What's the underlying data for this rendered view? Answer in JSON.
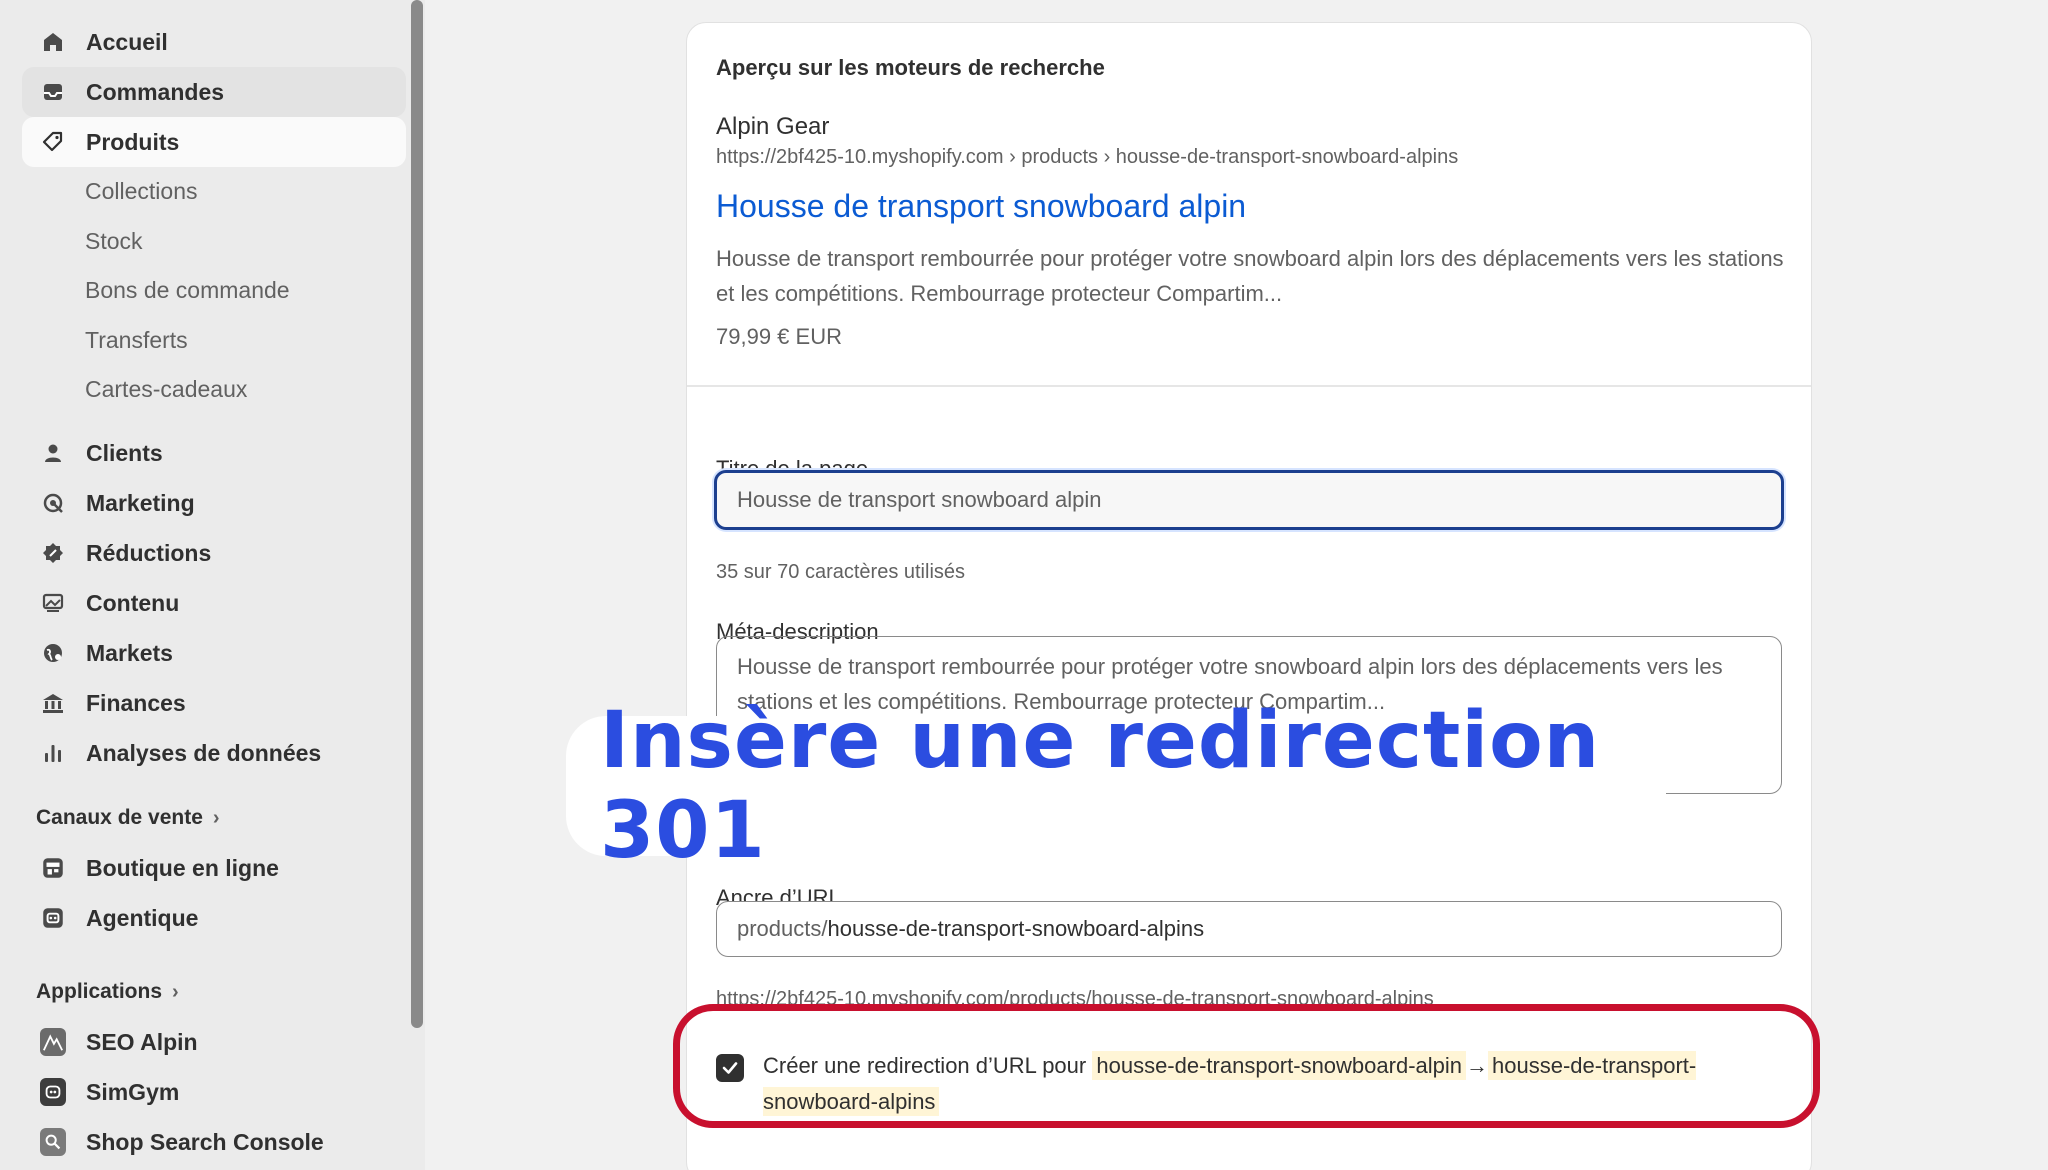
{
  "sidebar": {
    "items": [
      {
        "label": "Accueil",
        "icon": "home-icon"
      },
      {
        "label": "Commandes",
        "icon": "inbox-icon"
      },
      {
        "label": "Produits",
        "icon": "tag-icon"
      }
    ],
    "sub_items": [
      "Collections",
      "Stock",
      "Bons de commande",
      "Transferts",
      "Cartes-cadeaux"
    ],
    "items2": [
      {
        "label": "Clients",
        "icon": "person-icon"
      },
      {
        "label": "Marketing",
        "icon": "target-icon"
      },
      {
        "label": "Réductions",
        "icon": "discount-icon"
      },
      {
        "label": "Contenu",
        "icon": "content-icon"
      },
      {
        "label": "Markets",
        "icon": "globe-icon"
      },
      {
        "label": "Finances",
        "icon": "bank-icon"
      },
      {
        "label": "Analyses de données",
        "icon": "chart-bars-icon"
      }
    ],
    "sales_channels_label": "Canaux de vente",
    "sales_channels": [
      {
        "label": "Boutique en ligne",
        "icon": "store-icon"
      },
      {
        "label": "Agentique",
        "icon": "agent-icon"
      }
    ],
    "apps_label": "Applications",
    "apps": [
      {
        "label": "SEO Alpin",
        "icon": "mountain-app-icon"
      },
      {
        "label": "SimGym",
        "icon": "simgym-app-icon"
      },
      {
        "label": "Shop Search Console",
        "icon": "search-console-app-icon"
      }
    ],
    "chevron": "›"
  },
  "seo": {
    "card_title": "Aperçu sur les moteurs de recherche",
    "shop_name": "Alpin Gear",
    "shop_url": "https://2bf425-10.myshopify.com › products › housse-de-transport-snowboard-alpins",
    "product_title": "Housse de transport snowboard alpin",
    "product_desc": "Housse de transport rembourrée pour protéger votre snowboard alpin lors des déplacements vers les stations et les compétitions. Rembourrage protecteur Compartim...",
    "price": "79,99 € EUR",
    "page_title_label": "Titre de la page",
    "page_title_value": "Housse de transport snowboard alpin",
    "char_count": "35 sur 70 caractères utilisés",
    "meta_label": "Méta-description",
    "meta_value": "Housse de transport rembourrée pour protéger votre snowboard alpin lors des déplacements vers les stations et les compétitions. Rembourrage protecteur Compartim...",
    "url_label": "Ancre d’URL",
    "url_prefix": "products/",
    "url_slug": "housse-de-transport-snowboard-alpins",
    "full_url": "https://2bf425-10.myshopify.com/products/housse-de-transport-snowboard-alpins",
    "redirect_checked": true,
    "redirect_text_pre": "Créer une redirection d’URL pour",
    "redirect_old": "housse-de-transport-snowboard-alpin",
    "redirect_arrow": "→",
    "redirect_new": "housse-de-transport-snowboard-alpins"
  },
  "overlay": {
    "banner_text": "Insère une redirection 301"
  },
  "colors": {
    "link": "#0b5bd3",
    "banner_text": "#2b4de0",
    "highlight_box": "#c8102e"
  }
}
